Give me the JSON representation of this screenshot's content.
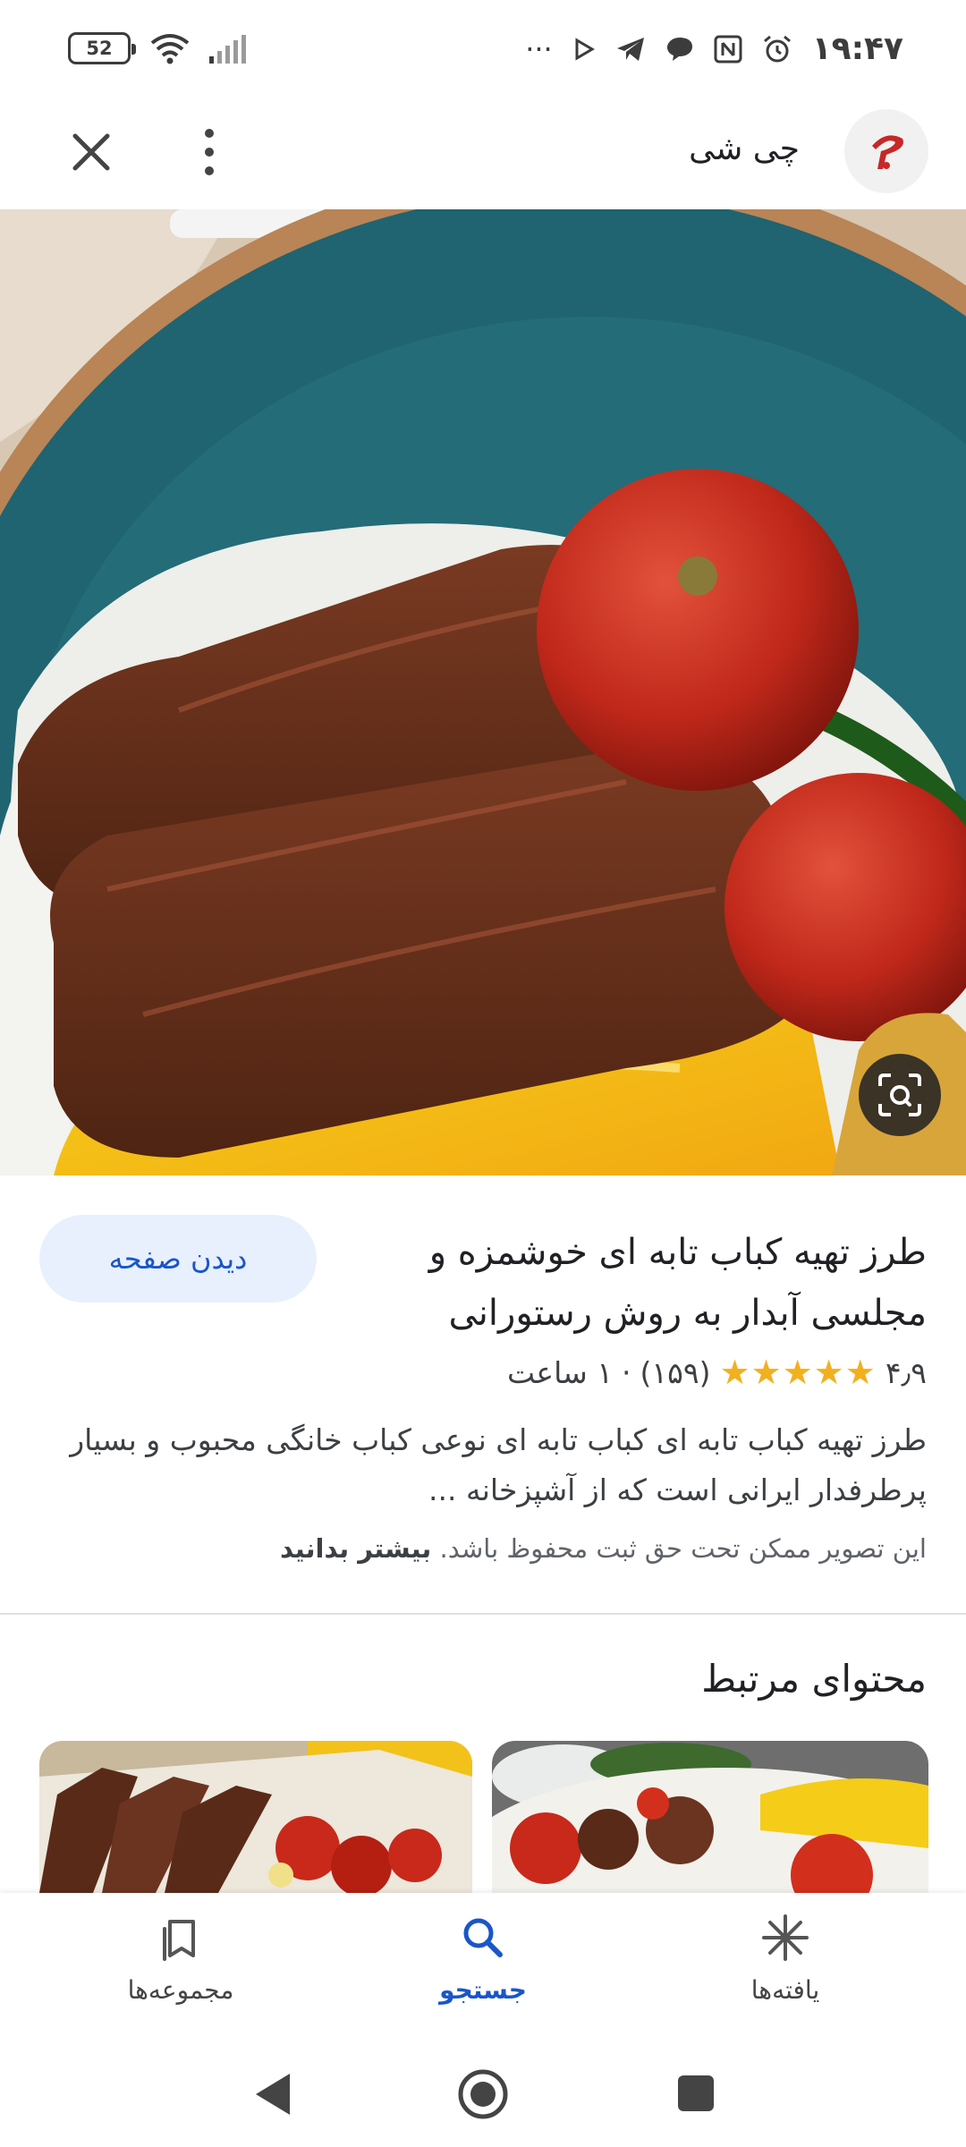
{
  "status_bar": {
    "battery": "52",
    "time": "۱۹:۴۷",
    "overflow": "···"
  },
  "header": {
    "site_name": "چی شی",
    "icons": [
      "close-icon",
      "more-vert-icon",
      "site-logo"
    ]
  },
  "result": {
    "title": "طرز تهیه کباب تابه ای خوشمزه و مجلسی آبدار به روش رستورانی",
    "visit_label": "دیدن صفحه",
    "rating_value": "۴٫۹",
    "stars": "★★★★★",
    "review_count": "(۱۵۹)",
    "separator": "·",
    "duration": "۱ ساعت",
    "description": "طرز تهیه کباب تابه ای کباب تابه ای نوعی کباب خانگی محبوب و بسیار پرطرفدار ایرانی است که از آشپزخانه ...",
    "copyright_text": "این تصویر ممکن تحت حق ثبت محفوظ باشد.",
    "learn_more": "بیشتر بدانید"
  },
  "related": {
    "title": "محتوای مرتبط"
  },
  "bottom_nav": {
    "items": [
      {
        "label": "مجموعه‌ها",
        "icon": "bookmarks-icon",
        "active": false
      },
      {
        "label": "جستجو",
        "icon": "search-icon",
        "active": true
      },
      {
        "label": "یافته‌ها",
        "icon": "asterisk-icon",
        "active": false
      }
    ]
  },
  "colors": {
    "accent": "#1a56c8",
    "accent_bg": "#e8f0fe",
    "star": "#f2b01e"
  }
}
